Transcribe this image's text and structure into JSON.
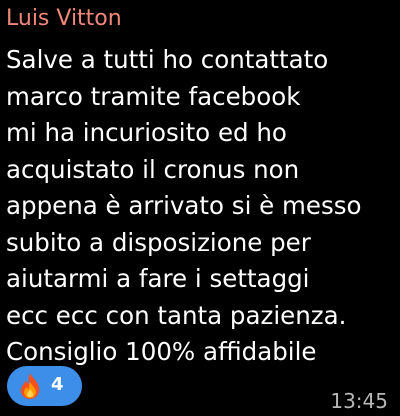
{
  "message": {
    "sender_name": "Luis Vitton",
    "lines": [
      "Salve a tutti ho contattato",
      "marco tramite facebook",
      "mi ha incuriosito ed ho",
      "acquistato il cronus non",
      "appena è arrivato si è messo",
      "subito a disposizione per",
      "aiutarmi a fare i settaggi",
      "ecc ecc con tanta pazienza.",
      "Consiglio 100% affidabile"
    ],
    "time": "13:45"
  },
  "reaction": {
    "icon": "fire-icon",
    "count": "4"
  },
  "colors": {
    "background": "#000000",
    "sender": "#f0877a",
    "text": "#ffffff",
    "time": "#b7b7b7",
    "reaction_bg": "#3d8ee8",
    "reaction_text": "#ffffff"
  }
}
